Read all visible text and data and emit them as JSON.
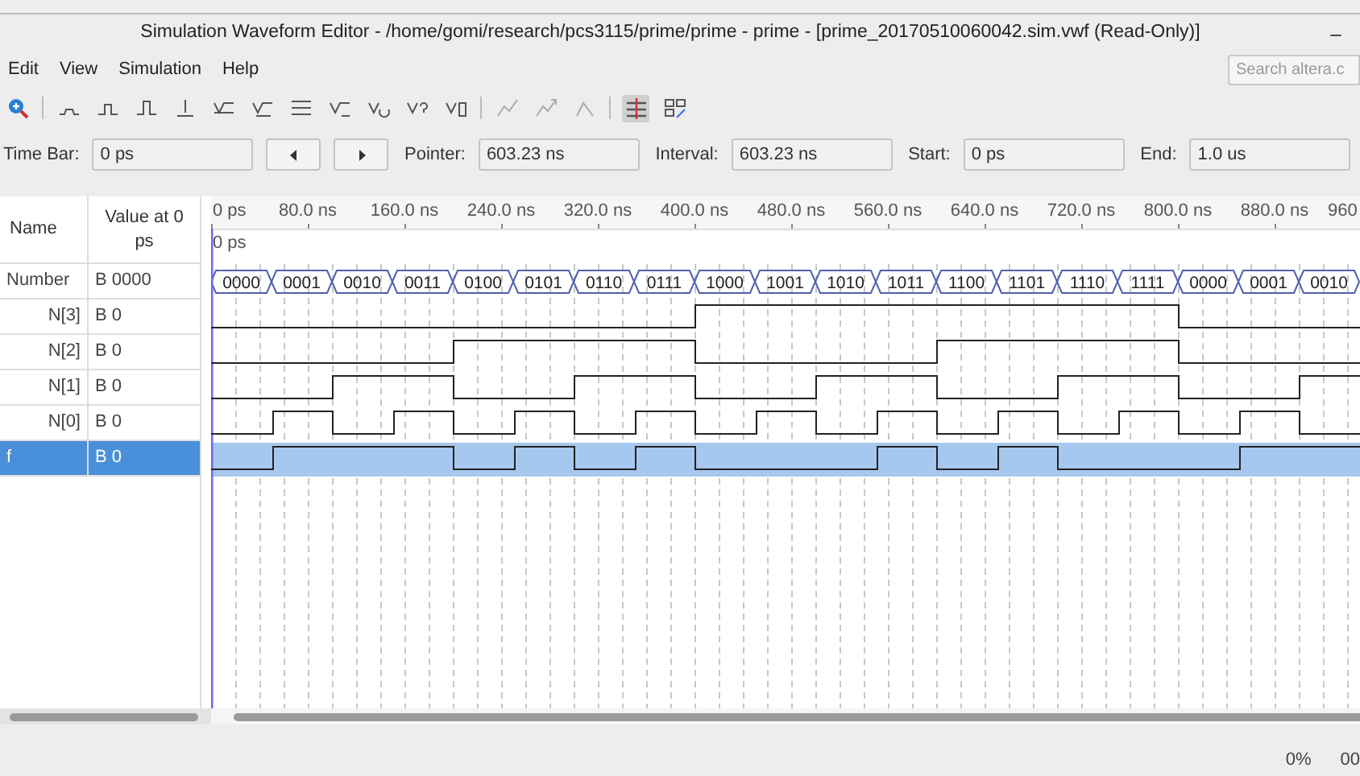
{
  "window": {
    "title": "Simulation Waveform Editor - /home/gomi/research/pcs3115/prime/prime - prime - [prime_20170510060042.sim.vwf (Read-Only)]",
    "minimize": "–"
  },
  "menu": [
    "Edit",
    "View",
    "Simulation",
    "Help"
  ],
  "search": {
    "placeholder": "Search altera.c"
  },
  "time_fields": [
    {
      "kind": "field",
      "label": "Time Bar:",
      "value": "0 ps"
    },
    {
      "kind": "nav"
    },
    {
      "kind": "field",
      "label": "Pointer:",
      "value": "603.23 ns"
    },
    {
      "kind": "field",
      "label": "Interval:",
      "value": "603.23 ns"
    },
    {
      "kind": "field",
      "label": "Start:",
      "value": "0 ps"
    },
    {
      "kind": "field",
      "label": "End:",
      "value": "1.0 us"
    }
  ],
  "columns": {
    "name": "Name",
    "value": "Value at 0 ps"
  },
  "ruler_ticks": [
    "0 ps",
    "80.0 ns",
    "160.0 ns",
    "240.0 ns",
    "320.0 ns",
    "400.0 ns",
    "480.0 ns",
    "560.0 ns",
    "640.0 ns",
    "720.0 ns",
    "800.0 ns",
    "880.0 ns",
    "960"
  ],
  "cursor_label": "0 ps",
  "signals": [
    {
      "name": "Number",
      "value": "B 0000",
      "kind": "bus",
      "selected": false,
      "waveform": [
        "0000",
        "0001",
        "0010",
        "0011",
        "0100",
        "0101",
        "0110",
        "0111",
        "1000",
        "1001",
        "1010",
        "1011",
        "1100",
        "1101",
        "1110",
        "1111",
        "0000",
        "0001",
        "0010"
      ]
    },
    {
      "name": "N[3]",
      "value": "B 0",
      "kind": "bit",
      "selected": false,
      "high": [
        false,
        false,
        false,
        false,
        false,
        false,
        false,
        false,
        true,
        true,
        true,
        true,
        true,
        true,
        true,
        true,
        false,
        false,
        false
      ]
    },
    {
      "name": "N[2]",
      "value": "B 0",
      "kind": "bit",
      "selected": false,
      "high": [
        false,
        false,
        false,
        false,
        true,
        true,
        true,
        true,
        false,
        false,
        false,
        false,
        true,
        true,
        true,
        true,
        false,
        false,
        false
      ]
    },
    {
      "name": "N[1]",
      "value": "B 0",
      "kind": "bit",
      "selected": false,
      "high": [
        false,
        false,
        true,
        true,
        false,
        false,
        true,
        true,
        false,
        false,
        true,
        true,
        false,
        false,
        true,
        true,
        false,
        false,
        true
      ]
    },
    {
      "name": "N[0]",
      "value": "B 0",
      "kind": "bit",
      "selected": false,
      "high": [
        false,
        true,
        false,
        true,
        false,
        true,
        false,
        true,
        false,
        true,
        false,
        true,
        false,
        true,
        false,
        true,
        false,
        true,
        false
      ]
    },
    {
      "name": "f",
      "value": "B 0",
      "kind": "bit",
      "selected": true,
      "high": [
        false,
        true,
        true,
        true,
        false,
        true,
        false,
        true,
        false,
        false,
        false,
        true,
        false,
        true,
        false,
        false,
        false,
        true,
        true
      ]
    }
  ],
  "status": [
    "0%",
    "00"
  ]
}
